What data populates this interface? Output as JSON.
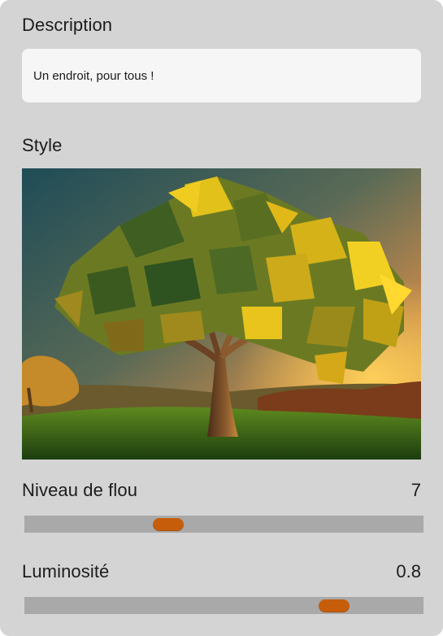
{
  "description": {
    "label": "Description",
    "value": "Un endroit, pour tous !"
  },
  "style": {
    "label": "Style",
    "image_name": "low-poly-tree-sunset"
  },
  "blur": {
    "label": "Niveau de flou",
    "value": "7",
    "position_fraction": 0.36
  },
  "brightness": {
    "label": "Luminosité",
    "value": "0.8",
    "position_fraction": 0.775
  },
  "colors": {
    "panel_bg": "#d4d4d4",
    "input_bg": "#f6f6f6",
    "track": "#a9a9a9",
    "thumb": "#c65d0b"
  }
}
